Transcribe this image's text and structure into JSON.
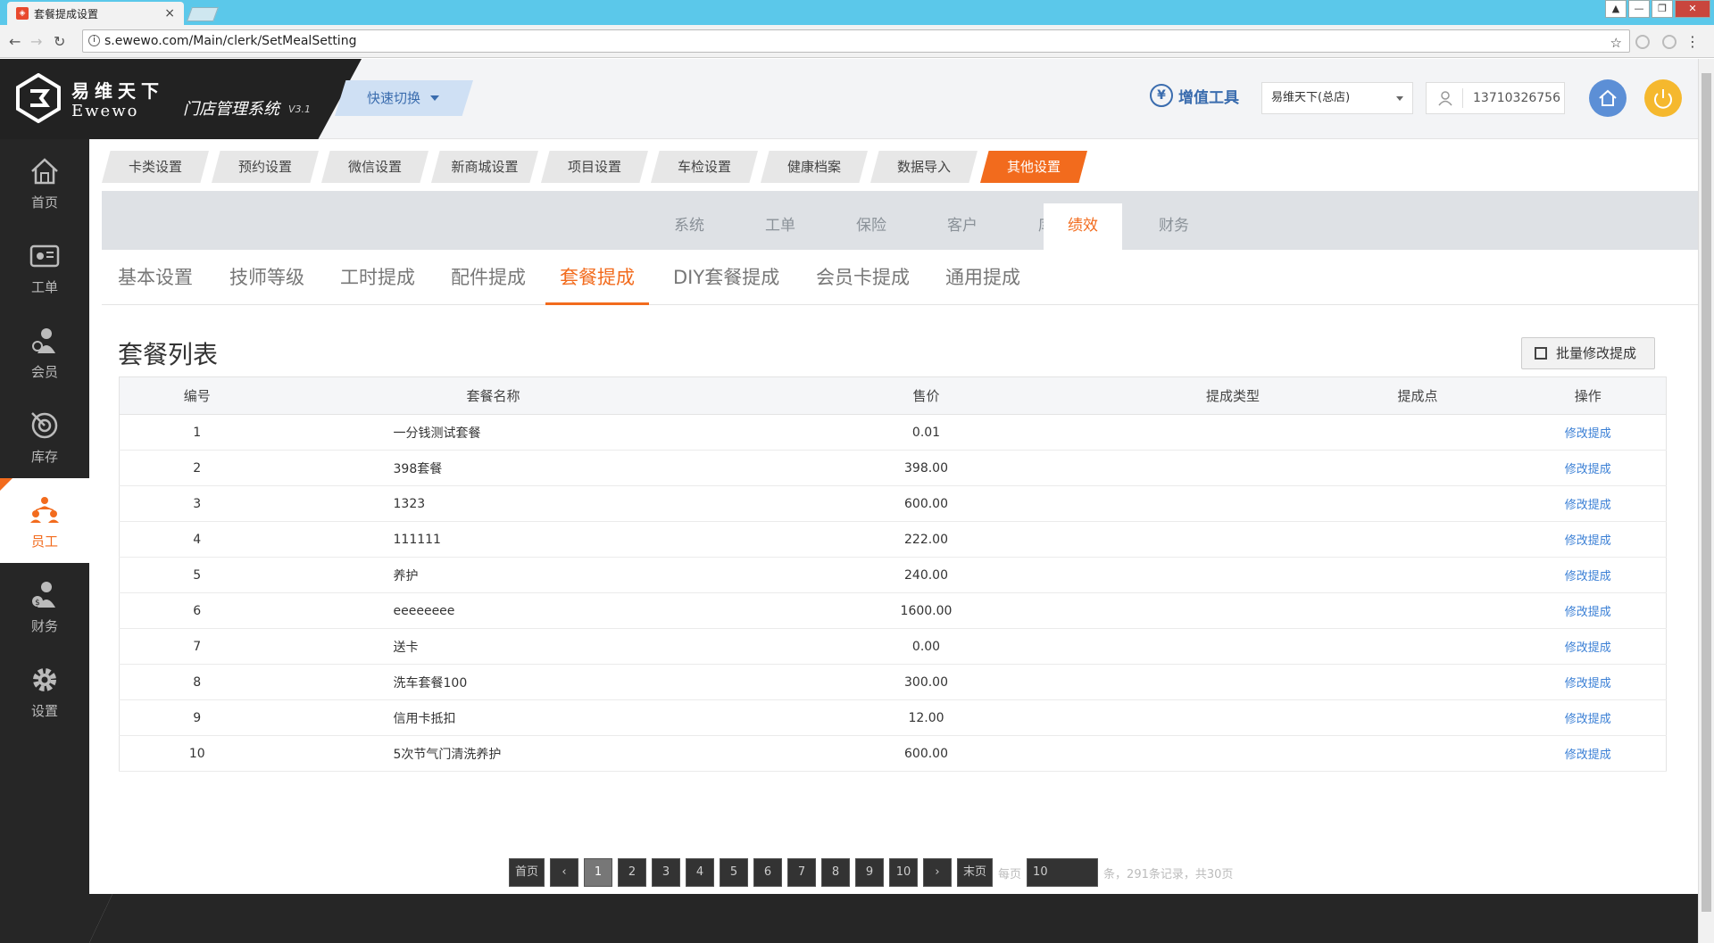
{
  "browser": {
    "tab_title": "套餐提成设置",
    "tab_close": "×",
    "url": "s.ewewo.com/Main/clerk/SetMealSetting"
  },
  "header": {
    "logo_cn": "易维天下",
    "logo_en": "Ewewo",
    "system_name": "门店管理系统",
    "version": "V3.1",
    "quick_switch": "快速切换",
    "tools_label": "增值工具",
    "tools_icon": "¥",
    "store": "易维天下(总店)",
    "user_phone": "13710326756"
  },
  "sidebar": {
    "items": [
      {
        "label": "首页",
        "icon": "home-icon"
      },
      {
        "label": "工单",
        "icon": "work-order-icon"
      },
      {
        "label": "会员",
        "icon": "member-icon"
      },
      {
        "label": "库存",
        "icon": "inventory-icon"
      },
      {
        "label": "员工",
        "icon": "staff-icon",
        "active": true
      },
      {
        "label": "财务",
        "icon": "finance-icon"
      },
      {
        "label": "设置",
        "icon": "settings-icon"
      }
    ]
  },
  "top_tabs": [
    "卡类设置",
    "预约设置",
    "微信设置",
    "新商城设置",
    "项目设置",
    "车检设置",
    "健康档案",
    "数据导入",
    "其他设置"
  ],
  "sub_tabs": [
    "系统",
    "工单",
    "保险",
    "客户",
    "库存",
    "绩效",
    "财务"
  ],
  "third_tabs": [
    "基本设置",
    "技师等级",
    "工时提成",
    "配件提成",
    "套餐提成",
    "DIY套餐提成",
    "会员卡提成",
    "通用提成"
  ],
  "list": {
    "title": "套餐列表",
    "batch_button": "批量修改提成",
    "columns": [
      "编号",
      "套餐名称",
      "售价",
      "提成类型",
      "提成点",
      "操作"
    ],
    "action_label": "修改提成",
    "rows": [
      {
        "no": "1",
        "name": "一分钱测试套餐",
        "price": "0.01",
        "type": "",
        "point": ""
      },
      {
        "no": "2",
        "name": "398套餐",
        "price": "398.00",
        "type": "",
        "point": ""
      },
      {
        "no": "3",
        "name": "1323",
        "price": "600.00",
        "type": "",
        "point": ""
      },
      {
        "no": "4",
        "name": "111111",
        "price": "222.00",
        "type": "",
        "point": ""
      },
      {
        "no": "5",
        "name": "养护",
        "price": "240.00",
        "type": "",
        "point": ""
      },
      {
        "no": "6",
        "name": "eeeeeeee",
        "price": "1600.00",
        "type": "",
        "point": ""
      },
      {
        "no": "7",
        "name": "送卡",
        "price": "0.00",
        "type": "",
        "point": ""
      },
      {
        "no": "8",
        "name": "洗车套餐100",
        "price": "300.00",
        "type": "",
        "point": ""
      },
      {
        "no": "9",
        "name": "信用卡抵扣",
        "price": "12.00",
        "type": "",
        "point": ""
      },
      {
        "no": "10",
        "name": "5次节气门清洗养护",
        "price": "600.00",
        "type": "",
        "point": ""
      }
    ]
  },
  "pager": {
    "first": "首页",
    "prev": "‹",
    "pages": [
      "1",
      "2",
      "3",
      "4",
      "5",
      "6",
      "7",
      "8",
      "9",
      "10"
    ],
    "current": "1",
    "next": "›",
    "last": "末页",
    "per_page_label": "每页",
    "per_page": "10",
    "summary": "条，291条记录，共30页"
  },
  "colors": {
    "accent": "#f26b1d",
    "link": "#3a7fd5",
    "sidebar": "#262626"
  }
}
